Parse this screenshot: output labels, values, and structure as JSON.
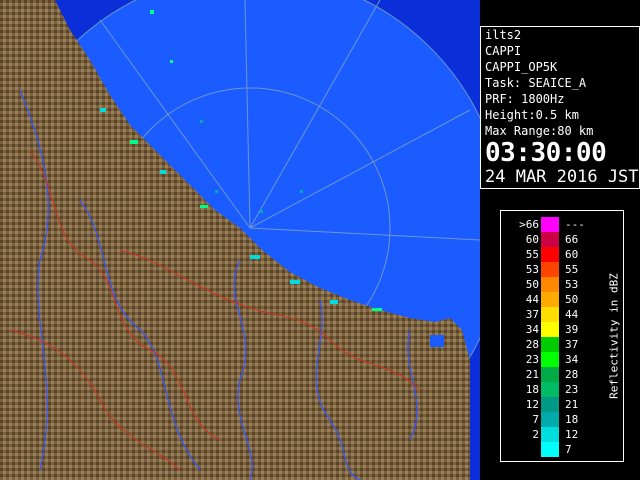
{
  "info": {
    "lines": [
      "ilts2",
      "CAPPI",
      "CAPPI_OP5K",
      "Task: SEAICE_A",
      "PRF: 1800Hz",
      "Height:0.5 km",
      "Max Range:80 km"
    ],
    "time": "03:30:00",
    "date": "24 MAR 2016 JST"
  },
  "legend": {
    "unit_label": "Reflectivity in dBZ",
    "rows": [
      {
        "lo": ">66",
        "hi": "---",
        "color": "#ff00ff"
      },
      {
        "lo": "60",
        "hi": "66",
        "color": "#cc0044"
      },
      {
        "lo": "55",
        "hi": "60",
        "color": "#ff0000"
      },
      {
        "lo": "53",
        "hi": "55",
        "color": "#ff4400"
      },
      {
        "lo": "50",
        "hi": "53",
        "color": "#ff8800"
      },
      {
        "lo": "44",
        "hi": "50",
        "color": "#ffaa00"
      },
      {
        "lo": "37",
        "hi": "44",
        "color": "#ffdd00"
      },
      {
        "lo": "34",
        "hi": "39",
        "color": "#ffff00"
      },
      {
        "lo": "28",
        "hi": "37",
        "color": "#00cc00"
      },
      {
        "lo": "23",
        "hi": "34",
        "color": "#00ff00"
      },
      {
        "lo": "21",
        "hi": "28",
        "color": "#00aa44"
      },
      {
        "lo": "18",
        "hi": "23",
        "color": "#00bb66"
      },
      {
        "lo": "12",
        "hi": "21",
        "color": "#009988"
      },
      {
        "lo": "7",
        "hi": "18",
        "color": "#00aaaa"
      },
      {
        "lo": "2",
        "hi": "12",
        "color": "#00dddd"
      },
      {
        "lo": "",
        "hi": "7",
        "color": "#00ffff"
      }
    ]
  },
  "colors": {
    "sea": "#0a3cff",
    "radar_circle": "#2e7bff",
    "land": "#7a6240",
    "river": "#3355ff",
    "border": "#cc3322"
  }
}
